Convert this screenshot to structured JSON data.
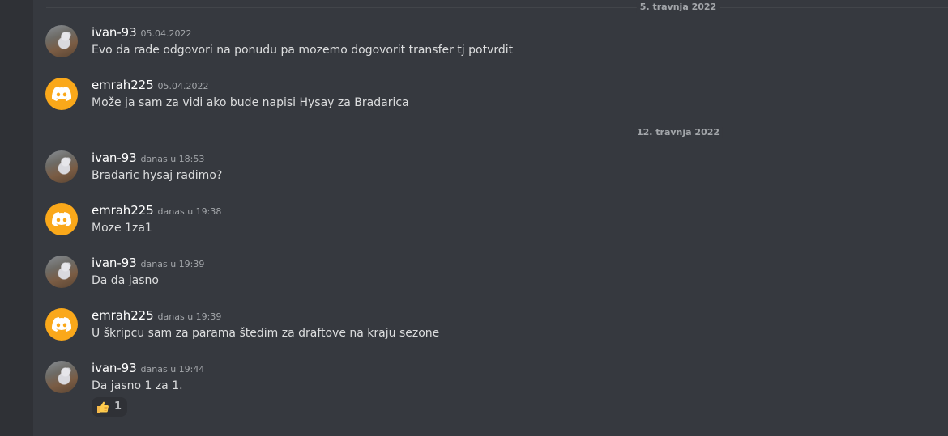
{
  "dividers": [
    {
      "label": "5. travnja 2022"
    },
    {
      "label": "12. travnja 2022"
    }
  ],
  "messages": [
    {
      "username": "ivan-93",
      "timestamp": "05.04.2022",
      "text": "Evo da rade odgovori na ponudu pa mozemo dogovorit transfer tj potvrdit",
      "avatar": "photo-avatar"
    },
    {
      "username": "emrah225",
      "timestamp": "05.04.2022",
      "text": "Može ja sam za vidi ako bude napisi Hysay za Bradarica",
      "avatar": "discord-logo-avatar"
    },
    {
      "username": "ivan-93",
      "timestamp": "danas u 18:53",
      "text": "Bradaric hysaj radimo?",
      "avatar": "photo-avatar"
    },
    {
      "username": "emrah225",
      "timestamp": "danas u 19:38",
      "text": "Moze 1za1",
      "avatar": "discord-logo-avatar"
    },
    {
      "username": "ivan-93",
      "timestamp": "danas u 19:39",
      "text": "Da da jasno",
      "avatar": "photo-avatar"
    },
    {
      "username": "emrah225",
      "timestamp": "danas u 19:39",
      "text": "U škripcu sam za parama štedim za draftove na kraju sezone",
      "avatar": "discord-logo-avatar"
    },
    {
      "username": "ivan-93",
      "timestamp": "danas u 19:44",
      "text": "Da jasno 1 za 1.",
      "avatar": "photo-avatar"
    }
  ],
  "reaction": {
    "emoji": "thumbs-up-icon",
    "count": "1"
  },
  "colors": {
    "background": "#36393f",
    "sidebar": "#2f3136",
    "discord_avatar": "#faa81a",
    "username": "#ffffff",
    "message_text": "#dcddde",
    "muted_text": "#a3a6aa"
  }
}
